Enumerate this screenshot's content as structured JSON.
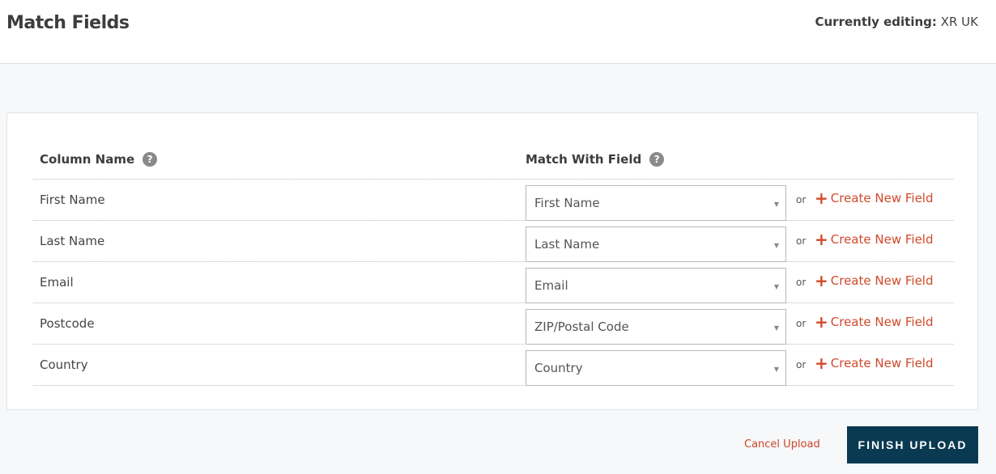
{
  "header": {
    "title": "Match Fields",
    "editing_label": "Currently editing:",
    "editing_value": "XR UK"
  },
  "table": {
    "col_name_header": "Column Name",
    "match_header": "Match With Field",
    "or_label": "or",
    "create_label": "Create New Field",
    "rows": [
      {
        "column": "First Name",
        "match": "First Name"
      },
      {
        "column": "Last Name",
        "match": "Last Name"
      },
      {
        "column": "Email",
        "match": "Email"
      },
      {
        "column": "Postcode",
        "match": "ZIP/Postal Code"
      },
      {
        "column": "Country",
        "match": "Country"
      }
    ]
  },
  "footer": {
    "cancel_label": "Cancel Upload",
    "finish_label": "FINISH UPLOAD"
  }
}
